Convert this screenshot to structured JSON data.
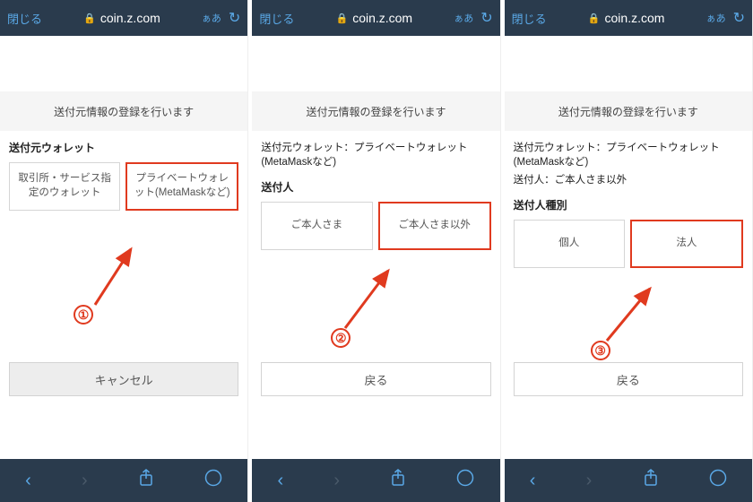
{
  "addr": {
    "close": "閉じる",
    "url": "coin.z.com",
    "aa": "ぁあ"
  },
  "banner": "送付元情報の登録を行います",
  "screen1": {
    "label_wallet": "送付元ウォレット",
    "opt_exchange": "取引所・サービス指定のウォレット",
    "opt_private": "プライベートウォレット(MetaMaskなど)",
    "cancel": "キャンセル",
    "annot": "①"
  },
  "screen2": {
    "info_wallet": "送付元ウォレット：プライベートウォレット(MetaMaskなど)",
    "label_sender": "送付人",
    "opt_self": "ご本人さま",
    "opt_other": "ご本人さま以外",
    "back": "戻る",
    "annot": "②"
  },
  "screen3": {
    "info_wallet": "送付元ウォレット：プライベートウォレット(MetaMaskなど)",
    "info_sender": "送付人：ご本人さま以外",
    "label_type": "送付人種別",
    "opt_individual": "個人",
    "opt_corporate": "法人",
    "back": "戻る",
    "annot": "③"
  }
}
